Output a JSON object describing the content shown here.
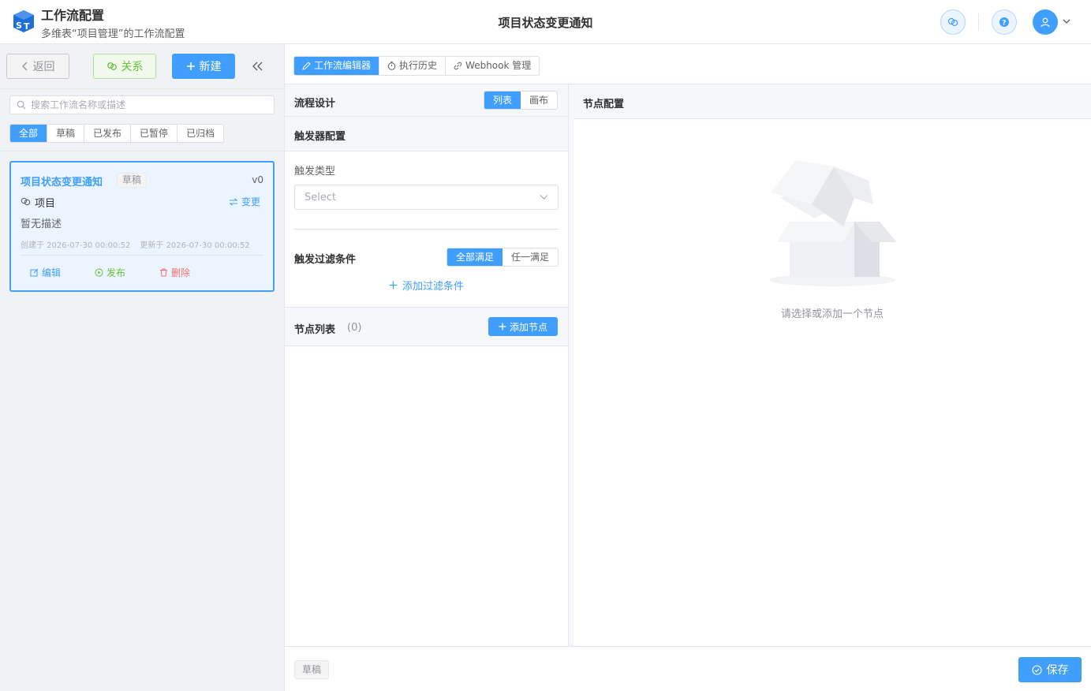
{
  "header": {
    "logo_text": "ST",
    "app_title": "工作流配置",
    "app_subtitle": "多维表“项目管理”的工作流配置",
    "page_title": "项目状态变更通知"
  },
  "sidebar": {
    "back_label": "返回",
    "relation_label": "关系",
    "new_label": "新建",
    "search_placeholder": "搜索工作流名称或描述",
    "filters": [
      "全部",
      "草稿",
      "已发布",
      "已暂停",
      "已归档"
    ],
    "active_filter": "全部",
    "workflow": {
      "name": "项目状态变更通知",
      "status": "草稿",
      "version": "v0",
      "table": "项目",
      "change_label": "变更",
      "description": "暂无描述",
      "created": "创建于 2026-07-30 00:00:52",
      "updated": "更新于 2026-07-30 00:00:52",
      "edit_label": "编辑",
      "publish_label": "发布",
      "delete_label": "删除"
    }
  },
  "tabs": [
    {
      "label": "工作流编辑器",
      "icon": "pen-icon",
      "active": true
    },
    {
      "label": "执行历史",
      "icon": "timer-icon",
      "active": false
    },
    {
      "label": "Webhook 管理",
      "icon": "link-icon",
      "active": false
    }
  ],
  "flow_design": {
    "title": "流程设计",
    "view_list": "列表",
    "view_canvas": "画布",
    "active_view": "列表"
  },
  "trigger": {
    "section_title": "触发器配置",
    "type_label": "触发类型",
    "type_placeholder": "Select",
    "filter_title": "触发过滤条件",
    "match_all": "全部满足",
    "match_any": "任一满足",
    "active_match": "全部满足",
    "add_filter_label": "添加过滤条件"
  },
  "nodes": {
    "title": "节点列表",
    "count": "(0)",
    "add_label": "添加节点"
  },
  "node_config": {
    "title": "节点配置",
    "empty_text": "请选择或添加一个节点"
  },
  "footer": {
    "status": "草稿",
    "save_label": "保存"
  },
  "colors": {
    "primary": "#409eff",
    "success": "#67c23a",
    "danger": "#f56c6c"
  }
}
